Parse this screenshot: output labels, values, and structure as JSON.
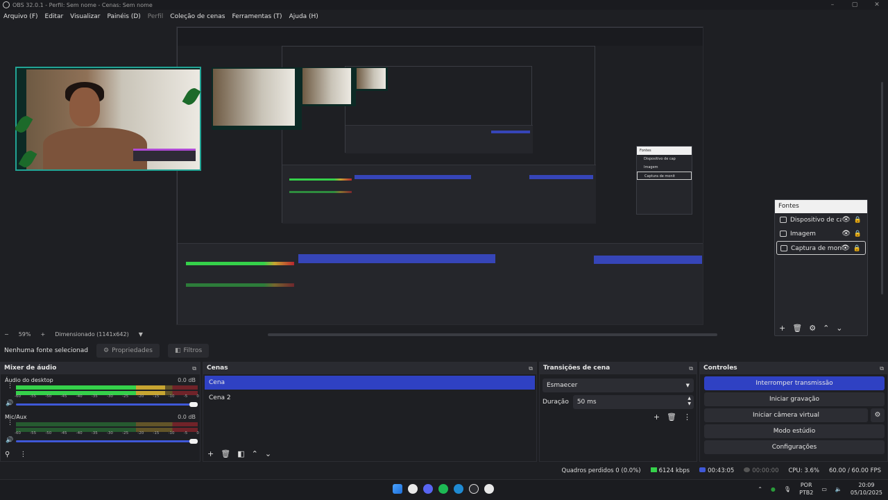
{
  "window": {
    "title": "OBS 32.0.1 - Perfil: Sem nome - Cenas: Sem nome"
  },
  "menu": [
    {
      "label": "Arquivo (F)",
      "enabled": true
    },
    {
      "label": "Editar",
      "enabled": true
    },
    {
      "label": "Visualizar",
      "enabled": true
    },
    {
      "label": "Painéis (D)",
      "enabled": true
    },
    {
      "label": "Perfil",
      "enabled": false
    },
    {
      "label": "Coleção de cenas",
      "enabled": true
    },
    {
      "label": "Ferramentas (T)",
      "enabled": true
    },
    {
      "label": "Ajuda (H)",
      "enabled": true
    }
  ],
  "preview": {
    "zoom": "59%",
    "scale_label": "Dimensionado (1141x642)"
  },
  "fontes": {
    "title": "Fontes",
    "items": [
      {
        "label": "Dispositivo de cap",
        "icon": "camera-icon",
        "selected": false
      },
      {
        "label": "Imagem",
        "icon": "image-icon",
        "selected": false
      },
      {
        "label": "Captura de monitc",
        "icon": "monitor-icon",
        "selected": true
      }
    ]
  },
  "nested_fontes": {
    "title": "Fontes",
    "items": [
      "Dispositivo de cap",
      "Imagem",
      "Captura de monit"
    ]
  },
  "sourcebar": {
    "no_source": "Nenhuma fonte selecionad",
    "properties": "Propriedades",
    "filters": "Filtros"
  },
  "mixer": {
    "title": "Mixer de áudio",
    "channels": [
      {
        "name": "Áudio do desktop",
        "db": "0.0 dB",
        "level": 0.82,
        "volume": 1.0
      },
      {
        "name": "Mic/Aux",
        "db": "0.0 dB",
        "level": 0.0,
        "volume": 1.0
      }
    ],
    "ticks": [
      "-60",
      "-55",
      "-50",
      "-45",
      "-40",
      "-35",
      "-30",
      "-25",
      "-20",
      "-15",
      "-10",
      "-5",
      "0"
    ]
  },
  "scenes": {
    "title": "Cenas",
    "items": [
      {
        "label": "Cena",
        "selected": true
      },
      {
        "label": "Cena 2",
        "selected": false
      }
    ]
  },
  "transitions": {
    "title": "Transições de cena",
    "selected": "Esmaecer",
    "duration_label": "Duração",
    "duration_value": "50 ms"
  },
  "controls": {
    "title": "Controles",
    "stop_stream": "Interromper transmissão",
    "start_recording": "Iniciar gravação",
    "start_virtual_cam": "Iniciar câmera virtual",
    "studio_mode": "Modo estúdio",
    "settings": "Configurações"
  },
  "status": {
    "dropped": "Quadros perdidos 0 (0.0%)",
    "bitrate": "6124 kbps",
    "stream_time": "00:43:05",
    "rec_time": "00:00:00",
    "cpu": "CPU: 3.6%",
    "fps": "60.00 / 60.00 FPS"
  },
  "taskbar": {
    "lang_top": "POR",
    "lang_bottom": "PTB2",
    "time": "20:09",
    "date": "05/10/2025"
  },
  "colors": {
    "accent": "#2f41c3",
    "meter_green": "#35d14a",
    "meter_yellow": "#c7a531",
    "meter_red": "#b8262e"
  }
}
